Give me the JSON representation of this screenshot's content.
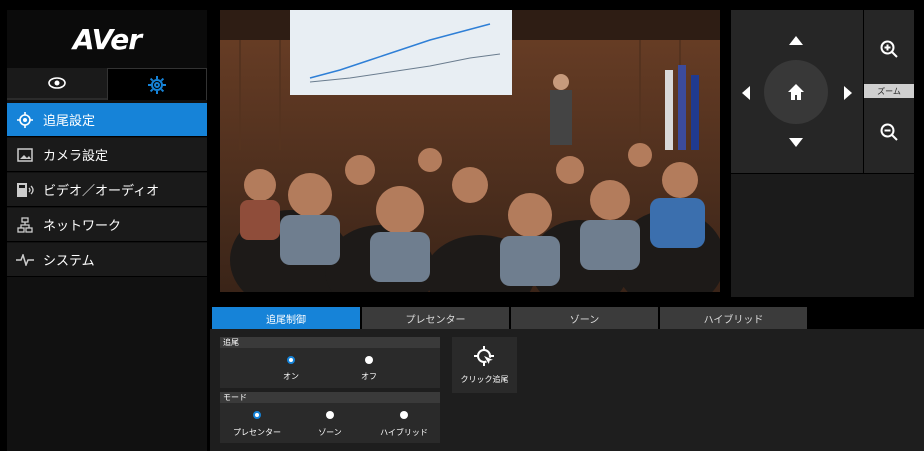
{
  "brand": {
    "logo_text": "AVer"
  },
  "sidebar": {
    "modes": [
      {
        "icon": "eye-icon"
      },
      {
        "icon": "gear-icon"
      }
    ],
    "items": [
      {
        "label": "追尾設定",
        "icon": "target-icon",
        "active": true
      },
      {
        "label": "カメラ設定",
        "icon": "image-icon"
      },
      {
        "label": "ビデオ／オーディオ",
        "icon": "video-audio-icon"
      },
      {
        "label": "ネットワーク",
        "icon": "network-icon"
      },
      {
        "label": "システム",
        "icon": "pulse-icon"
      }
    ]
  },
  "ptz": {
    "zoom_label": "ズーム"
  },
  "tabs": [
    {
      "label": "追尾制御",
      "active": true
    },
    {
      "label": "プレセンター"
    },
    {
      "label": "ゾーン"
    },
    {
      "label": "ハイブリッド"
    }
  ],
  "tracking": {
    "title": "追尾",
    "options": [
      {
        "label": "オン",
        "selected": true
      },
      {
        "label": "オフ",
        "selected": false
      }
    ]
  },
  "mode": {
    "title": "モード",
    "options": [
      {
        "label": "プレセンター",
        "selected": true
      },
      {
        "label": "ゾーン",
        "selected": false
      },
      {
        "label": "ハイブリッド",
        "selected": false
      }
    ]
  },
  "click_track": {
    "label": "クリック追尾"
  },
  "colors": {
    "accent": "#1683d8"
  }
}
